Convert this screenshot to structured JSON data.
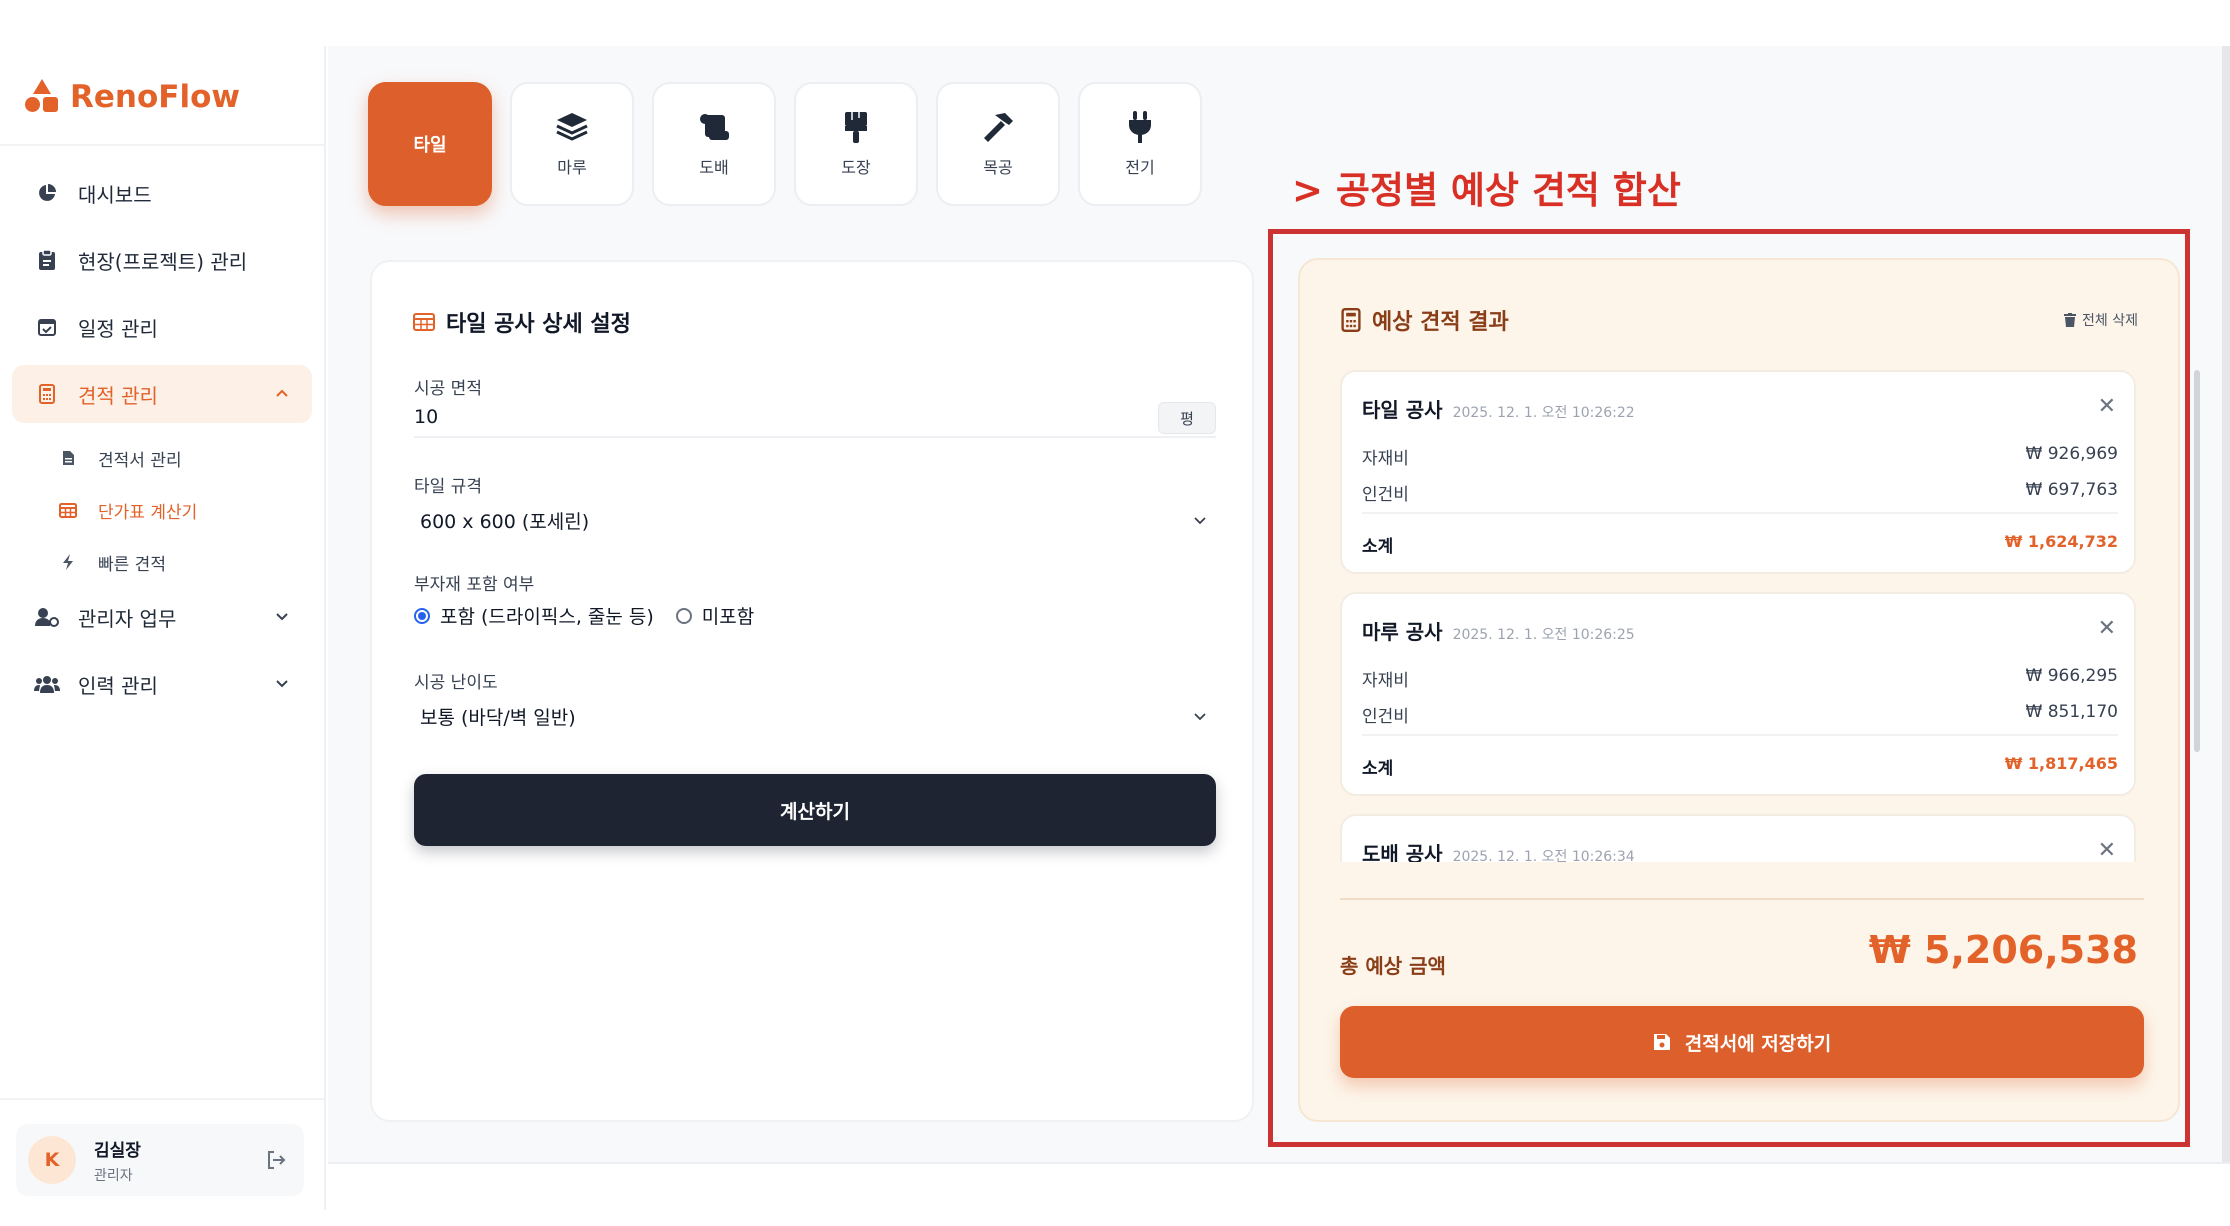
{
  "app": {
    "name": "RenoFlow",
    "brand_color": "#e2622a"
  },
  "sidebar": {
    "items": [
      {
        "label": "대시보드",
        "icon": "pie-chart-icon"
      },
      {
        "label": "현장(프로젝트) 관리",
        "icon": "clipboard-icon"
      },
      {
        "label": "일정 관리",
        "icon": "calendar-check-icon"
      },
      {
        "label": "견적 관리",
        "icon": "calculator-icon",
        "active": true,
        "expanded": true
      },
      {
        "label": "관리자 업무",
        "icon": "user-gear-icon"
      },
      {
        "label": "인력 관리",
        "icon": "users-icon"
      }
    ],
    "sub_items": [
      {
        "label": "견적서 관리",
        "icon": "file-icon"
      },
      {
        "label": "단가표 계산기",
        "icon": "table-icon",
        "active": true
      },
      {
        "label": "빠른 견적",
        "icon": "bolt-icon"
      }
    ],
    "user": {
      "initial": "K",
      "name": "김실장",
      "role": "관리자"
    }
  },
  "tabs": [
    {
      "label": "타일",
      "icon": "tile-icon",
      "active": true
    },
    {
      "label": "마루",
      "icon": "layers-icon"
    },
    {
      "label": "도배",
      "icon": "scroll-icon"
    },
    {
      "label": "도장",
      "icon": "paint-brush-icon"
    },
    {
      "label": "목공",
      "icon": "hammer-icon"
    },
    {
      "label": "전기",
      "icon": "plug-icon"
    }
  ],
  "settings": {
    "title": "타일 공사 상세 설정",
    "area_label": "시공 면적",
    "area_value": "10",
    "area_unit": "평",
    "tile_spec_label": "타일 규격",
    "tile_spec_value": "600 x 600 (포세린)",
    "accessory_label": "부자재 포함 여부",
    "accessory_include": "포함 (드라이픽스, 줄눈 등)",
    "accessory_exclude": "미포함",
    "difficulty_label": "시공 난이도",
    "difficulty_value": "보통 (바닥/벽 일반)",
    "calculate_button": "계산하기"
  },
  "annotation": "> 공정별 예상 견적 합산",
  "result": {
    "title": "예상 견적 결과",
    "clear_all": "전체 삭제",
    "items": [
      {
        "name": "타일 공사",
        "time": "2025. 12. 1. 오전 10:26:22",
        "material_label": "자재비",
        "material": "₩ 926,969",
        "labor_label": "인건비",
        "labor": "₩ 697,763",
        "subtotal_label": "소계",
        "subtotal": "₩ 1,624,732"
      },
      {
        "name": "마루 공사",
        "time": "2025. 12. 1. 오전 10:26:25",
        "material_label": "자재비",
        "material": "₩ 966,295",
        "labor_label": "인건비",
        "labor": "₩ 851,170",
        "subtotal_label": "소계",
        "subtotal": "₩ 1,817,465"
      },
      {
        "name": "도배 공사",
        "time": "2025. 12. 1. 오전 10:26:34"
      }
    ],
    "total_label": "총 예상 금액",
    "total_amount": "₩ 5,206,538",
    "save_button": "견적서에 저장하기"
  }
}
